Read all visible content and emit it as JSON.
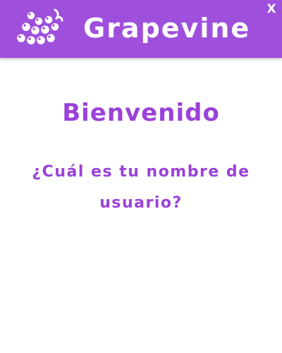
{
  "header": {
    "title": "Grapevine",
    "logo_icon": "grapes-logo-icon",
    "close_label": "X",
    "background_color": "#9e4fdc"
  },
  "main": {
    "welcome": "Bienvenido",
    "question": "¿Cuál es tu nombre de usuario?",
    "accent_color": "#9b42d9"
  }
}
